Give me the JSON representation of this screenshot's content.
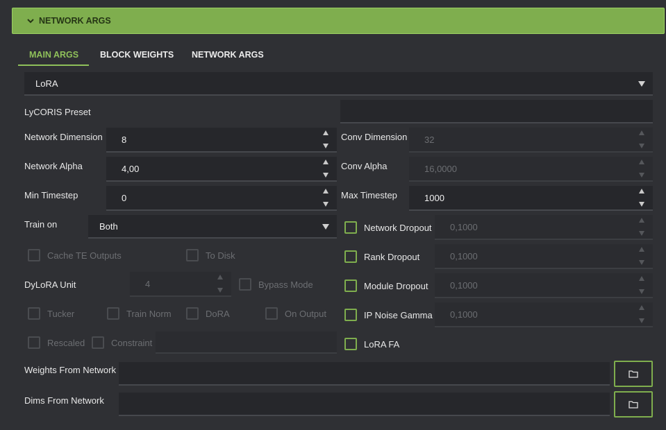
{
  "header": {
    "title": "NETWORK ARGS"
  },
  "tabs": [
    {
      "label": "MAIN ARGS",
      "active": true
    },
    {
      "label": "BLOCK WEIGHTS",
      "active": false
    },
    {
      "label": "NETWORK ARGS",
      "active": false
    }
  ],
  "network_type": {
    "selected": "LoRA"
  },
  "lycoris_preset": {
    "label": "LyCORIS Preset",
    "value": ""
  },
  "network_dimension": {
    "label": "Network Dimension",
    "value": "8"
  },
  "conv_dimension": {
    "label": "Conv Dimension",
    "value": "32"
  },
  "network_alpha": {
    "label": "Network Alpha",
    "value": "4,00"
  },
  "conv_alpha": {
    "label": "Conv Alpha",
    "value": "16,0000"
  },
  "min_timestep": {
    "label": "Min Timestep",
    "value": "0"
  },
  "max_timestep": {
    "label": "Max Timestep",
    "value": "1000"
  },
  "train_on": {
    "label": "Train on",
    "selected": "Both"
  },
  "network_dropout": {
    "label": "Network Dropout",
    "value": "0,1000"
  },
  "cache_te_outputs": {
    "label": "Cache TE Outputs"
  },
  "to_disk": {
    "label": "To Disk"
  },
  "rank_dropout": {
    "label": "Rank Dropout",
    "value": "0,1000"
  },
  "dylora_unit": {
    "label": "DyLoRA Unit",
    "value": "4"
  },
  "bypass_mode": {
    "label": "Bypass Mode"
  },
  "module_dropout": {
    "label": "Module Dropout",
    "value": "0,1000"
  },
  "tucker": {
    "label": "Tucker"
  },
  "train_norm": {
    "label": "Train Norm"
  },
  "dora": {
    "label": "DoRA"
  },
  "on_output": {
    "label": "On Output"
  },
  "ip_noise_gamma": {
    "label": "IP Noise Gamma",
    "value": "0,1000"
  },
  "rescaled": {
    "label": "Rescaled"
  },
  "constraint": {
    "label": "Constraint",
    "value": ""
  },
  "lora_fa": {
    "label": "LoRA FA"
  },
  "weights_from_network": {
    "label": "Weights From Network",
    "value": ""
  },
  "dims_from_network": {
    "label": "Dims From Network",
    "value": ""
  },
  "colors": {
    "accent": "#7fae4e",
    "active_tab": "#8fc05a",
    "background": "#2f3034"
  }
}
